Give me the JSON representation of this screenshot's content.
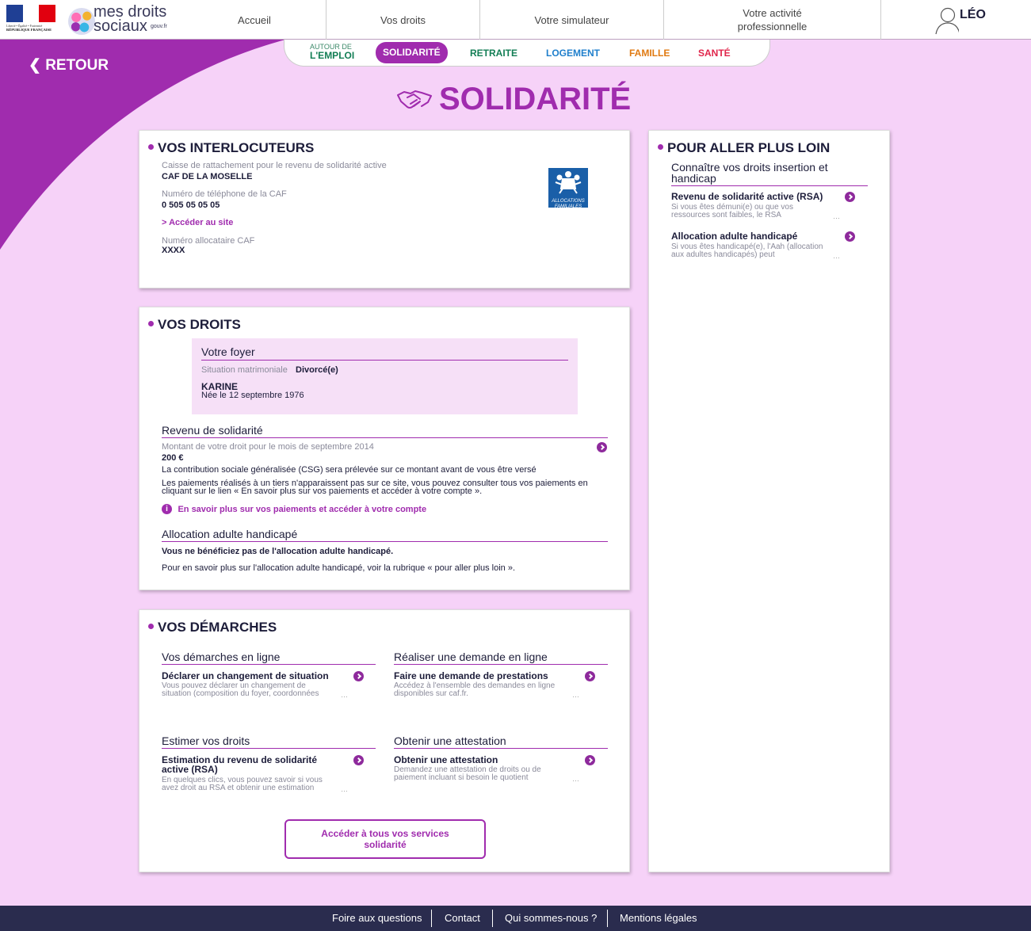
{
  "header": {
    "rf_motto": "Liberté • Égalité • Fraternité",
    "rf_name": "RÉPUBLIQUE FRANÇAISE",
    "logo_line1": "mes droits",
    "logo_line2": "sociaux",
    "logo_gouv": "gouv.fr",
    "nav": [
      "Accueil",
      "Vos droits",
      "Votre simulateur",
      "Votre activité professionnelle"
    ],
    "user_name": "LÉO"
  },
  "categories": {
    "emploi_small": "AUTOUR DE",
    "emploi_big": "L'EMPLOI",
    "items": [
      "SOLIDARITÉ",
      "RETRAITE",
      "LOGEMENT",
      "FAMILLE",
      "SANTÉ"
    ]
  },
  "back_label": "RETOUR",
  "page_title": "SOLIDARITÉ",
  "interlocuteurs": {
    "title": "VOS INTERLOCUTEURS",
    "caisse_label": "Caisse de rattachement pour le revenu de solidarité active",
    "caisse_value": "CAF DE LA MOSELLE",
    "phone_label": "Numéro de téléphone de la CAF",
    "phone_value": "0 505 05 05 05",
    "site_link": "> Accéder au site",
    "alloc_label": "Numéro allocataire CAF",
    "alloc_value": "XXXX",
    "caf_logo_text1": "ALLOCATIONS",
    "caf_logo_text2": "FAMILIALES"
  },
  "droits": {
    "title": "VOS DROITS",
    "foyer_title": "Votre foyer",
    "situation_label": "Situation matrimoniale",
    "situation_value": "Divorcé(e)",
    "person_name": "KARINE",
    "person_birth": "Née le 12 septembre 1976",
    "rsa_title": "Revenu de solidarité",
    "rsa_amount_label": "Montant de votre droit pour le mois de septembre 2014",
    "rsa_amount": "200 €",
    "rsa_csg": "La contribution sociale généralisée (CSG) sera prélevée sur ce montant avant de vous être versé",
    "rsa_payments": "Les paiements réalisés à un tiers n'apparaissent pas sur ce site, vous pouvez consulter tous vos paiements en cliquant sur le lien « En savoir plus sur vos paiements et accéder à votre compte ».",
    "rsa_link": "En savoir plus sur vos paiements et accéder à votre compte",
    "aah_title": "Allocation adulte handicapé",
    "aah_none": "Vous ne bénéficiez pas de l'allocation adulte handicapé.",
    "aah_more": "Pour en savoir plus sur l'allocation adulte handicapé, voir la rubrique « pour aller plus loin »."
  },
  "demarches": {
    "title": "VOS DÉMARCHES",
    "groups": [
      {
        "heading": "Vos démarches en ligne",
        "item_title": "Déclarer un changement de situation",
        "item_desc1": "Vous pouvez déclarer un changement de",
        "item_desc2": "situation (composition du foyer, coordonnées"
      },
      {
        "heading": "Réaliser une demande en ligne",
        "item_title": "Faire une demande de prestations",
        "item_desc1": "Accédez à l'ensemble des demandes en ligne",
        "item_desc2": "disponibles sur caf.fr."
      },
      {
        "heading": "Estimer vos droits",
        "item_title": "Estimation du revenu de solidarité",
        "item_title2": "active (RSA)",
        "item_desc1": "En quelques clics, vous pouvez savoir si vous",
        "item_desc2": "avez droit au RSA et obtenir une estimation"
      },
      {
        "heading": "Obtenir une attestation",
        "item_title": "Obtenir une attestation",
        "item_desc1": "Demandez une attestation de droits ou de",
        "item_desc2": "paiement incluant si besoin le quotient"
      }
    ],
    "button_line1": "Accéder à tous vos services",
    "button_line2": "solidarité"
  },
  "plus_loin": {
    "title": "POUR ALLER PLUS LOIN",
    "subtitle_line1": "Connaître vos droits insertion et",
    "subtitle_line2": "handicap",
    "items": [
      {
        "title": "Revenu de solidarité active (RSA)",
        "desc1": "Si vous êtes démuni(e) ou que vos",
        "desc2": "ressources sont faibles, le RSA"
      },
      {
        "title": "Allocation adulte handicapé",
        "desc1": "Si vous êtes handicapé(e), l'Aah (allocation",
        "desc2": "aux adultes handicapés) peut"
      }
    ]
  },
  "footer": {
    "links": [
      "Foire aux questions",
      "Contact",
      "Qui sommes-nous ?",
      "Mentions légales"
    ]
  },
  "colors": {
    "accent": "#a02cae",
    "background": "#f6d2f8",
    "retraite": "#137e55",
    "logement": "#1f7fcc",
    "famille": "#e07a12",
    "sante": "#e0264b",
    "footer": "#2a2c4e"
  }
}
